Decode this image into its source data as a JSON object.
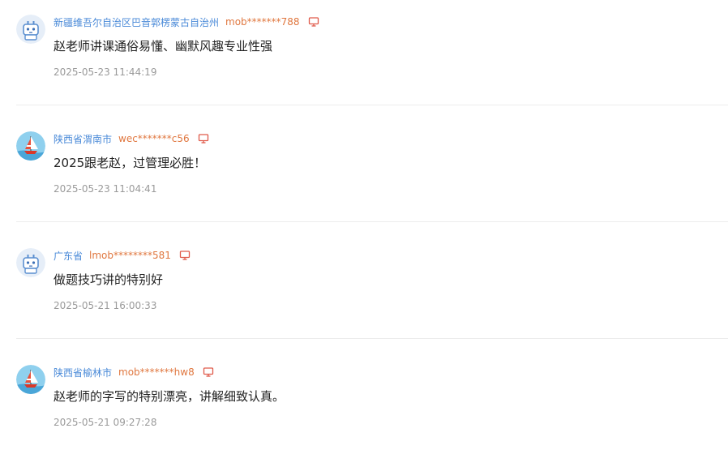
{
  "comments": [
    {
      "location": "新疆维吾尔自治区巴音郭楞蒙古自治州",
      "username": "mob*******788",
      "content": "赵老师讲课通俗易懂、幽默风趣专业性强",
      "time": "2025-05-23 11:44:19",
      "avatar": "robot-avatar",
      "device_icon": "computer-monitor-icon"
    },
    {
      "location": "陕西省渭南市",
      "username": "wec*******c56",
      "content": "2025跟老赵，过管理必胜！",
      "time": "2025-05-23 11:04:41",
      "avatar": "sailboat-avatar",
      "device_icon": "computer-monitor-icon"
    },
    {
      "location": "广东省",
      "username": "lmob********581",
      "content": "做题技巧讲的特别好",
      "time": "2025-05-21 16:00:33",
      "avatar": "robot-avatar",
      "device_icon": "computer-monitor-icon"
    },
    {
      "location": "陕西省榆林市",
      "username": "mob*******hw8",
      "content": "赵老师的字写的特别漂亮，讲解细致认真。",
      "time": "2025-05-21 09:27:28",
      "avatar": "sailboat-avatar",
      "device_icon": "computer-monitor-icon"
    }
  ],
  "colors": {
    "location": "#4a8ad8",
    "username": "#e0773f",
    "device_icon": "#e05a4a",
    "content": "#222222",
    "time": "#9a9a9a",
    "divider": "#ececec"
  }
}
